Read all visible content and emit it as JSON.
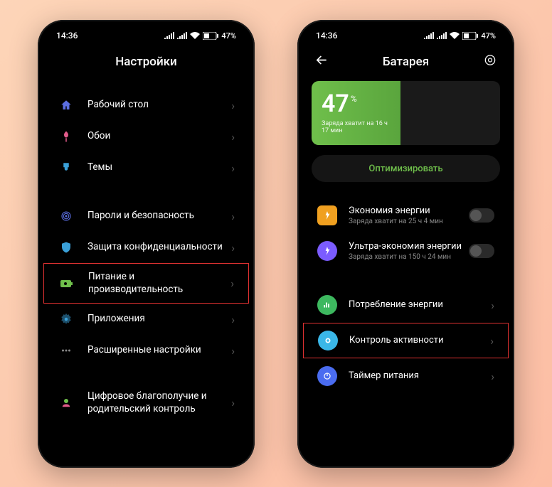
{
  "left": {
    "status": {
      "time": "14:36",
      "battery": "47"
    },
    "title": "Настройки",
    "items": [
      {
        "label": "Рабочий стол",
        "icon": "home",
        "color": "#5b6ee1"
      },
      {
        "label": "Обои",
        "icon": "tulip",
        "color": "#e15b8a"
      },
      {
        "label": "Темы",
        "icon": "brush",
        "color": "#3aa0d8"
      },
      {
        "label": "Пароли и безопасность",
        "icon": "fingerprint",
        "color": "#5b6ee1"
      },
      {
        "label": "Защита конфиденциальности",
        "icon": "shield",
        "color": "#3aa0d8"
      },
      {
        "label": "Питание и производительность",
        "icon": "battery",
        "color": "#6fbf4b",
        "highlight": true
      },
      {
        "label": "Приложения",
        "icon": "gear",
        "color": "#3aa0d8"
      },
      {
        "label": "Расширенные настройки",
        "icon": "dots",
        "color": "#888"
      },
      {
        "label": "Цифровое благополучие и родительский контроль",
        "icon": "heart",
        "color": "#6fbf4b"
      }
    ]
  },
  "right": {
    "status": {
      "time": "14:36",
      "battery": "47"
    },
    "title": "Батарея",
    "battery": {
      "pct": "47",
      "sub": "Заряда хватит на 16 ч 17 мин",
      "fill_color_left": "#6fbf4b",
      "fill_color_right": "#4a7a3d"
    },
    "optimize": "Оптимизировать",
    "modes": [
      {
        "title": "Экономия энергии",
        "sub": "Заряда хватит на 25 ч 4 мин",
        "icon_bg": "#f0a020"
      },
      {
        "title": "Ультра-экономия энергии",
        "sub": "Заряда хватит на 150 ч 24 мин",
        "icon_bg": "#7b5cff"
      }
    ],
    "nav": [
      {
        "title": "Потребление энергии",
        "icon_bg": "#3db85f"
      },
      {
        "title": "Контроль активности",
        "icon_bg": "#3ab7e8",
        "highlight": true
      },
      {
        "title": "Таймер питания",
        "icon_bg": "#4a6cf0"
      }
    ]
  }
}
